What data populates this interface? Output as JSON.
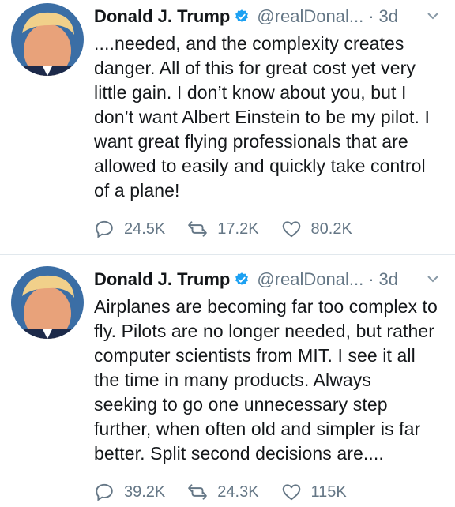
{
  "tweets": [
    {
      "author_name": "Donald J. Trump",
      "handle": "@realDonal...",
      "separator": "·",
      "time": "3d",
      "text": "....needed, and the complexity creates danger. All of this for great cost yet very little gain. I don’t know about you, but I don’t want Albert Einstein to be my pilot. I want great flying professionals that are allowed to easily and quickly take control of a plane!",
      "replies": "24.5K",
      "retweets": "17.2K",
      "likes": "80.2K"
    },
    {
      "author_name": "Donald J. Trump",
      "handle": "@realDonal...",
      "separator": "·",
      "time": "3d",
      "text": "Airplanes are becoming far too complex to fly. Pilots are no longer needed, but rather computer scientists from MIT. I see it all the time in many products. Always seeking to go one unnecessary step further, when often old and simpler is far better. Split second decisions are....",
      "replies": "39.2K",
      "retweets": "24.3K",
      "likes": "115K"
    }
  ],
  "colors": {
    "verified": "#1da1f2",
    "muted": "#657786",
    "text": "#14171a",
    "divider": "#e1e8ed"
  }
}
